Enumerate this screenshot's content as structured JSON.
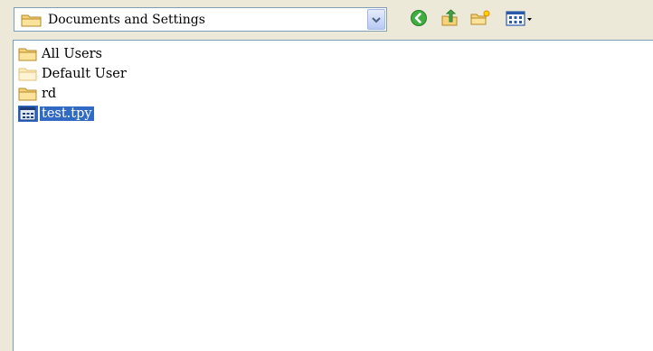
{
  "look_in": {
    "current_folder": "Documents and Settings",
    "folder_icon": "folder-icon",
    "dropdown_icon": "chevron-down-icon"
  },
  "toolbar": {
    "buttons": [
      {
        "icon": "back-icon"
      },
      {
        "icon": "up-folder-icon"
      },
      {
        "icon": "new-folder-icon"
      },
      {
        "icon": "view-menu-icon"
      }
    ]
  },
  "files": [
    {
      "name": "All Users",
      "icon": "folder-icon",
      "selected": false
    },
    {
      "name": "Default User",
      "icon": "folder-light-icon",
      "selected": false
    },
    {
      "name": "rd",
      "icon": "folder-icon",
      "selected": false
    },
    {
      "name": "test.tpy",
      "icon": "file-icon",
      "selected": true
    }
  ],
  "colors": {
    "selection": "#316ac5",
    "window_bg": "#ece9d8",
    "border": "#7f9db9"
  }
}
